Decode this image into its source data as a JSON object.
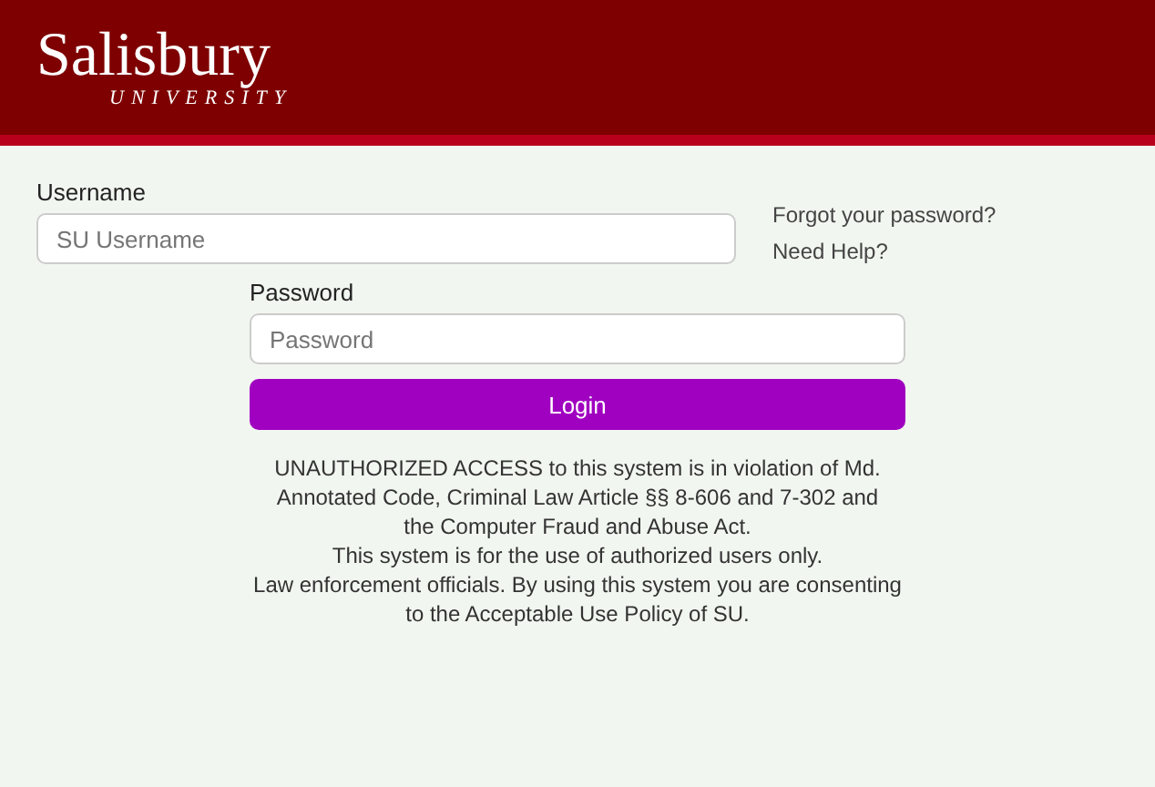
{
  "header": {
    "logo": "Salisbury",
    "logo_sub": "UNIVERSITY"
  },
  "form": {
    "username_label": "Username",
    "username_placeholder": "SU Username",
    "forgot_link": "Forgot your password?",
    "help_link": "Need Help?",
    "password_label": "Password",
    "password_placeholder": "Password",
    "login_button": "Login"
  },
  "notice": [
    "UNAUTHORIZED ACCESS to this system is in violation of Md.",
    "Annotated Code, Criminal Law Article §§ 8-606 and 7-302 and",
    "the Computer Fraud and Abuse Act.",
    "This system is for the use of authorized users only.",
    "Law enforcement officials. By using this system you are consenting",
    "to the Acceptable Use Policy of SU."
  ]
}
